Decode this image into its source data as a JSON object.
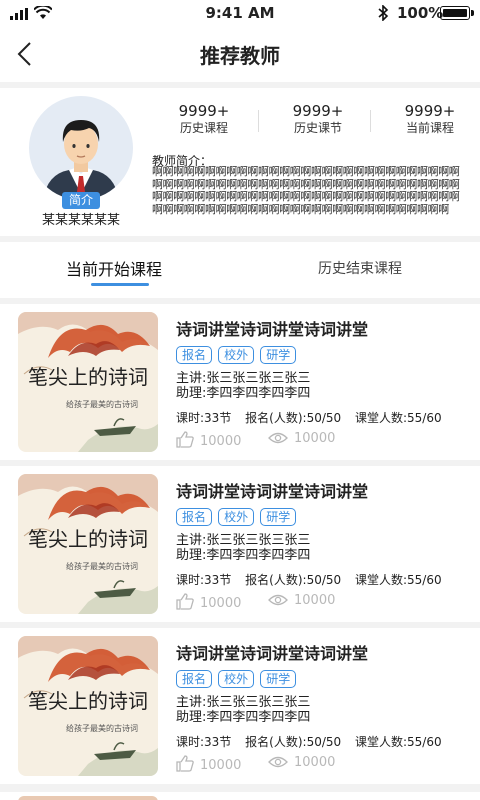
{
  "status_bar": {
    "time": "9:41 AM",
    "battery": "100%"
  },
  "nav": {
    "title": "推荐教师"
  },
  "teacher": {
    "name": "某某某某某某",
    "intro_badge": "简介",
    "stats": [
      {
        "value": "9999+",
        "label": "历史课程"
      },
      {
        "value": "9999+",
        "label": "历史课节"
      },
      {
        "value": "9999+",
        "label": "当前课程"
      }
    ],
    "bio_label": "教师简介：",
    "bio_text": "啊啊啊啊啊啊啊啊啊啊啊啊啊啊啊啊啊啊啊啊啊啊啊啊啊啊啊啊啊啊啊啊啊啊啊啊啊啊啊啊啊啊啊啊啊啊啊啊啊啊啊啊啊啊啊啊啊啊啊啊啊啊啊啊啊啊啊啊啊啊啊啊啊啊啊啊啊啊啊啊啊啊啊啊啊啊啊啊啊啊啊啊啊啊啊啊啊啊啊啊啊啊啊啊啊啊啊啊啊啊啊啊啊啊啊"
  },
  "tabs": {
    "active": "当前开始课程",
    "inactive": "历史结束课程"
  },
  "courses": [
    {
      "title": "诗词讲堂诗词讲堂诗词讲堂",
      "tags": [
        "报名",
        "校外",
        "研学"
      ],
      "lecturer": "主讲:张三张三张三张三",
      "assistant": "助理:李四李四李四李四",
      "lessons": "课时:33节",
      "enrolled": "报名(人数):50/50",
      "capacity": "课堂人数:55/60",
      "likes": "10000",
      "views": "10000",
      "cover_title": "笔尖上的诗词",
      "cover_subtitle": "给孩子最美的古诗词"
    },
    {
      "title": "诗词讲堂诗词讲堂诗词讲堂",
      "tags": [
        "报名",
        "校外",
        "研学"
      ],
      "lecturer": "主讲:张三张三张三张三",
      "assistant": "助理:李四李四李四李四",
      "lessons": "课时:33节",
      "enrolled": "报名(人数):50/50",
      "capacity": "课堂人数:55/60",
      "likes": "10000",
      "views": "10000",
      "cover_title": "笔尖上的诗词",
      "cover_subtitle": "给孩子最美的古诗词"
    },
    {
      "title": "诗词讲堂诗词讲堂诗词讲堂",
      "tags": [
        "报名",
        "校外",
        "研学"
      ],
      "lecturer": "主讲:张三张三张三张三",
      "assistant": "助理:李四李四李四李四",
      "lessons": "课时:33节",
      "enrolled": "报名(人数):50/50",
      "capacity": "课堂人数:55/60",
      "likes": "10000",
      "views": "10000",
      "cover_title": "笔尖上的诗词",
      "cover_subtitle": "给孩子最美的古诗词"
    }
  ],
  "colors": {
    "accent": "#3d8fe0",
    "muted": "#b8b8b8"
  },
  "icons": [
    "signal-icon",
    "wifi-icon",
    "bluetooth-icon",
    "battery-icon",
    "back-arrow-icon",
    "thumbs-up-icon",
    "eye-icon"
  ]
}
